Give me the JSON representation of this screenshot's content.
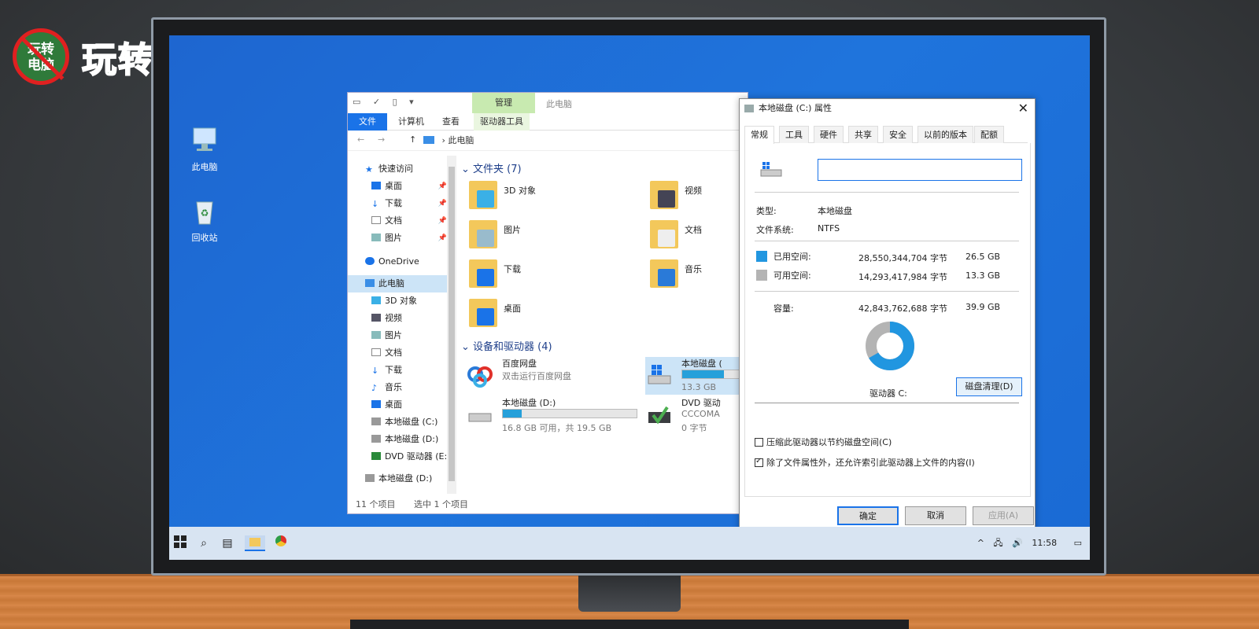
{
  "logo": {
    "badge_line1": "玩转",
    "badge_line2": "电脑",
    "text": "玩转电脑"
  },
  "desktop": {
    "icons": [
      {
        "label": "此电脑"
      },
      {
        "label": "回收站"
      }
    ]
  },
  "explorer": {
    "manage_tab": "管理",
    "title": "此电脑",
    "tabs": [
      "文件",
      "计算机",
      "查看",
      "驱动器工具"
    ],
    "address": "此电脑",
    "nav": {
      "quick_access": "快速访问",
      "quick_items": [
        "桌面",
        "下载",
        "文档",
        "图片"
      ],
      "onedrive": "OneDrive",
      "this_pc": "此电脑",
      "pc_items": [
        "3D 对象",
        "视频",
        "图片",
        "文档",
        "下载",
        "音乐",
        "桌面",
        "本地磁盘 (C:)",
        "本地磁盘 (D:)",
        "DVD 驱动器 (E:"
      ],
      "bottom_item": "本地磁盘 (D:)"
    },
    "folders_header": "文件夹 (7)",
    "folders": [
      "3D 对象",
      "视频",
      "图片",
      "文档",
      "下载",
      "音乐",
      "桌面"
    ],
    "devices_header": "设备和驱动器 (4)",
    "devices": {
      "baidu_name": "百度网盘",
      "baidu_sub": "双击运行百度网盘",
      "c_name": "本地磁盘 (",
      "c_sub": "13.3 GB",
      "c_fill": 0.66,
      "d_name": "本地磁盘 (D:)",
      "d_sub": "16.8 GB 可用，共 19.5 GB",
      "d_fill": 0.14,
      "dvd_name": "DVD 驱动",
      "dvd_sub1": "CCCOMA",
      "dvd_sub2": "0 字节"
    },
    "status": {
      "items": "11 个项目",
      "selected": "选中 1 个项目"
    }
  },
  "properties": {
    "title": "本地磁盘 (C:) 属性",
    "close": "✕",
    "tabs": [
      "常规",
      "工具",
      "硬件",
      "共享",
      "安全",
      "以前的版本",
      "配额"
    ],
    "name_value": "",
    "type_label": "类型:",
    "type_value": "本地磁盘",
    "fs_label": "文件系统:",
    "fs_value": "NTFS",
    "used_label": "已用空间:",
    "used_bytes": "28,550,344,704 字节",
    "used_gb": "26.5 GB",
    "free_label": "可用空间:",
    "free_bytes": "14,293,417,984 字节",
    "free_gb": "13.3 GB",
    "capacity_label": "容量:",
    "capacity_bytes": "42,843,762,688 字节",
    "capacity_gb": "39.9 GB",
    "used_fraction": 0.666,
    "drive_label": "驱动器 C:",
    "cleanup_button": "磁盘清理(D)",
    "compress_label": "压缩此驱动器以节约磁盘空间(C)",
    "compress_checked": false,
    "index_label": "除了文件属性外，还允许索引此驱动器上文件的内容(I)",
    "index_checked": true,
    "ok": "确定",
    "cancel": "取消",
    "apply": "应用(A)",
    "colors": {
      "used": "#2196e0",
      "free": "#b4b4b4"
    }
  },
  "taskbar": {
    "time": "11:58",
    "tray_arrow": "^"
  }
}
